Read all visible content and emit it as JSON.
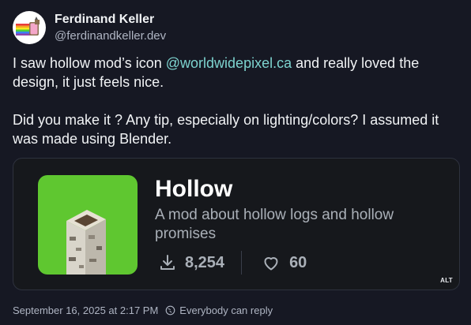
{
  "author": {
    "name": "Ferdinand Keller",
    "handle": "@ferdinandkeller.dev"
  },
  "post": {
    "line1_before": "I saw hollow mod’s icon ",
    "mention": "@worldwidepixel.ca",
    "line1_after": " and really loved the design, it just feels nice.",
    "paragraph2": "Did you make it ? Any tip, especially on lighting/colors? I assumed it was made using Blender."
  },
  "card": {
    "title": "Hollow",
    "description": "A mod about hollow logs and hollow promises",
    "downloads": "8,254",
    "likes": "60",
    "alt_label": "ALT",
    "icon_bg": "#5fc730"
  },
  "footer": {
    "timestamp": "September 16, 2025 at 2:17 PM",
    "reply_setting": "Everybody can reply"
  },
  "icons": {
    "download": "download-icon",
    "heart": "heart-icon",
    "globe": "globe-icon"
  },
  "colors": {
    "background": "#161823",
    "mention": "#7dd3cf",
    "card_background": "#16181c"
  }
}
